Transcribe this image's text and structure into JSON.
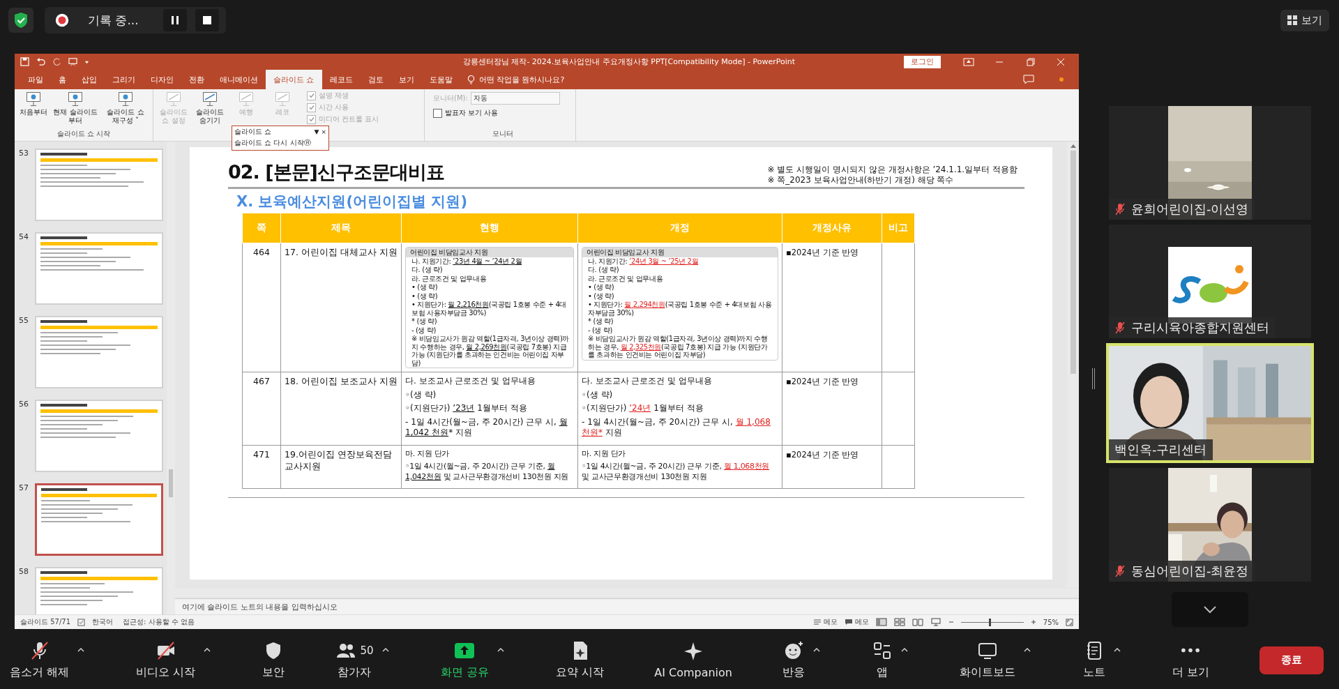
{
  "meeting": {
    "recording": "기록 중...",
    "view_button": "보기"
  },
  "powerpoint": {
    "title": "강릉센터장님 제작- 2024.보육사업안내 주요개정사항 PPT[Compatibility Mode]  -  PowerPoint",
    "login": "로그인",
    "tabs": [
      {
        "label": "파일",
        "selected": false
      },
      {
        "label": "홈",
        "selected": false
      },
      {
        "label": "삽입",
        "selected": false
      },
      {
        "label": "그리기",
        "selected": false
      },
      {
        "label": "디자인",
        "selected": false
      },
      {
        "label": "전환",
        "selected": false
      },
      {
        "label": "애니메이션",
        "selected": false
      },
      {
        "label": "슬라이드 쇼",
        "selected": true
      },
      {
        "label": "레코드",
        "selected": false
      },
      {
        "label": "검토",
        "selected": false
      },
      {
        "label": "보기",
        "selected": false
      },
      {
        "label": "도움말",
        "selected": false
      }
    ],
    "tell_me": "어떤 작업을 원하시나요?",
    "ribbon": {
      "start_group": {
        "label": "슬라이드 쇼 시작",
        "buttons": [
          {
            "label": "처음부터",
            "disabled": false
          },
          {
            "label": "현재 슬라이드부터",
            "disabled": false
          },
          {
            "label": "슬라이드 쇼 재구성",
            "caret": "˅",
            "disabled": false
          }
        ]
      },
      "setup_buttons": [
        {
          "label": "슬라이드 쇼 설정",
          "disabled": true
        },
        {
          "label": "슬라이드 숨기기",
          "disabled": false
        },
        {
          "label": "예행",
          "disabled": true
        },
        {
          "label": "레코",
          "disabled": true
        }
      ],
      "checks": [
        {
          "label": "설명 재생",
          "checked": true,
          "disabled": true
        },
        {
          "label": "시간 사용",
          "checked": true,
          "disabled": true
        },
        {
          "label": "미디어 컨트롤 표시",
          "checked": true,
          "disabled": true
        }
      ],
      "monitor_group": {
        "label": "모니터",
        "monitor_label": "모니터(M):",
        "monitor_value": "자동",
        "presenter": {
          "label": "발표자 보기 사용",
          "checked": false
        }
      }
    },
    "popup": {
      "title": "슬라이드 쇼",
      "menu_arrow": "▼",
      "close": "×",
      "item": "슬라이드 쇼 다시 시작Ⓡ"
    },
    "thumbnails": [
      {
        "number": "53",
        "selected": false
      },
      {
        "number": "54",
        "selected": false
      },
      {
        "number": "55",
        "selected": false
      },
      {
        "number": "56",
        "selected": false
      },
      {
        "number": "57",
        "selected": true
      },
      {
        "number": "58",
        "selected": false
      }
    ],
    "slide": {
      "title": "02. [본문]신구조문대비표",
      "notes": [
        "※ 별도 시행일이 명시되지 않은 개정사항은 ’24.1.1.일부터 적용함",
        "※ 쪽_2023 보육사업안내(하반기 개정) 해당 쪽수"
      ],
      "subtitle": "Ⅹ. 보육예산지원(어린이집별 지원)",
      "table": {
        "columns": [
          "쪽",
          "제목",
          "현행",
          "개정",
          "개정사유",
          "비고"
        ],
        "rows": [
          {
            "page": "464",
            "title": "17. 어린이집 대체교사 지원",
            "reason": "▪2024년 기준 반영",
            "current": {
              "kind": "box",
              "heading": "어린이집 비담임교사 지원",
              "lines": [
                [
                  {
                    "text": "나. 지원기간: "
                  },
                  {
                    "text": "’23년 4월 ~ ’24년 2월",
                    "kind": "underline"
                  }
                ],
                [
                  {
                    "text": "다. (생 략)"
                  }
                ],
                [
                  {
                    "text": "라. 근로조건 및 업무내용"
                  }
                ],
                [
                  {
                    "text": "• (생 략)"
                  }
                ],
                [
                  {
                    "text": "• (생 략)"
                  }
                ],
                [
                  {
                    "text": "• 지원단가: "
                  },
                  {
                    "text": "월 2,216천원",
                    "kind": "underline"
                  },
                  {
                    "text": "(국공립 1호봉 수준 + 4대보험 사용자부담금 30%)"
                  }
                ],
                [
                  {
                    "text": "* (생 략)"
                  }
                ],
                [
                  {
                    "text": "- (생 략)"
                  }
                ],
                [
                  {
                    "text": "※ 비담임교사가 원감 역할(1급자격, 3년이상 경력)까지 수행하는 경우, "
                  },
                  {
                    "text": "월 2,269천원",
                    "kind": "underline"
                  },
                  {
                    "text": "(국공립 7호봉) 지급 가능 (지원단가를 초과하는 인건비는 어린이집 자부담)"
                  }
                ]
              ]
            },
            "revised": {
              "kind": "box",
              "heading": "어린이집 비담임교사 지원",
              "lines": [
                [
                  {
                    "text": "나. 지원기간: "
                  },
                  {
                    "text": "’24년 3월 ~ ’25년 2월",
                    "kind": "changed"
                  }
                ],
                [
                  {
                    "text": "다. (생 략)"
                  }
                ],
                [
                  {
                    "text": "라. 근로조건 및 업무내용"
                  }
                ],
                [
                  {
                    "text": "• (생 략)"
                  }
                ],
                [
                  {
                    "text": "• (생 략)"
                  }
                ],
                [
                  {
                    "text": "• 지원단가: "
                  },
                  {
                    "text": "월 2,294천원",
                    "kind": "changed"
                  },
                  {
                    "text": "(국공립 1호봉 수준 + 4대보험 사용자부담금 30%)"
                  }
                ],
                [
                  {
                    "text": "* (생 략)"
                  }
                ],
                [
                  {
                    "text": "- (생 략)"
                  }
                ],
                [
                  {
                    "text": "※ 비담임교사가 원감 역할(1급자격, 3년이상 경력)까지 수행하는 경우, "
                  },
                  {
                    "text": "월 2,325천원",
                    "kind": "changed"
                  },
                  {
                    "text": "(국공립 7호봉) 지급 가능 (지원단가를 초과하는 인건비는 어린이집 자부담)"
                  }
                ]
              ]
            }
          },
          {
            "page": "467",
            "title": "18. 어린이집 보조교사 지원",
            "reason": "▪2024년 기준 반영",
            "current": {
              "kind": "text",
              "lines": [
                [
                  {
                    "text": "다. 보조교사 근로조건 및 업무내용"
                  }
                ],
                [
                  {
                    "text": "◦(생 략)"
                  }
                ],
                [
                  {
                    "text": "◦(지원단가) "
                  },
                  {
                    "text": "’23년",
                    "kind": "underline"
                  },
                  {
                    "text": " 1월부터 적용"
                  }
                ],
                [
                  {
                    "text": "- 1일 4시간(월~금, 주 20시간) 근무 시, "
                  },
                  {
                    "text": "월 1,042 천원",
                    "kind": "underline"
                  },
                  {
                    "text": "* 지원"
                  }
                ]
              ]
            },
            "revised": {
              "kind": "text",
              "lines": [
                [
                  {
                    "text": "다. 보조교사 근로조건 및 업무내용"
                  }
                ],
                [
                  {
                    "text": "◦(생 략)"
                  }
                ],
                [
                  {
                    "text": "◦(지원단가) "
                  },
                  {
                    "text": "’24년",
                    "kind": "changed"
                  },
                  {
                    "text": " 1월부터 적용"
                  }
                ],
                [
                  {
                    "text": "- 1일 4시간(월~금, 주 20시간) 근무 시, "
                  },
                  {
                    "text": "월 1,068천원*",
                    "kind": "changed"
                  },
                  {
                    "text": " 지원"
                  }
                ]
              ]
            }
          },
          {
            "page": "471",
            "title": "19.어린이집 연장보육전담교사지원",
            "reason": "▪2024년 기준 반영",
            "current": {
              "kind": "small",
              "lines": [
                [
                  {
                    "text": "마. 지원 단가"
                  }
                ],
                [
                  {
                    "text": "◦1일 4시간(월~금, 주 20시간) 근무 기준, "
                  },
                  {
                    "text": "월 1,042천원",
                    "kind": "underline"
                  },
                  {
                    "text": " 및 교사근무환경개선비 130천원 지원"
                  }
                ]
              ]
            },
            "revised": {
              "kind": "small",
              "lines": [
                [
                  {
                    "text": "마. 지원 단가"
                  }
                ],
                [
                  {
                    "text": "◦1일 4시간(월~금, 주 20시간) 근무 기준, "
                  },
                  {
                    "text": "월 1,068천원",
                    "kind": "changed"
                  },
                  {
                    "text": " 및 교사근무환경개선비 130천원 지원"
                  }
                ]
              ]
            }
          }
        ]
      }
    },
    "notes_placeholder": "여기에 슬라이드 노트의 내용을 입력하십시오",
    "status": {
      "slide": "슬라이드 57/71",
      "language": "한국어",
      "accessibility": "접근성: 사용할 수 없음",
      "notes": "메모",
      "comments": "메모",
      "zoom": "75%",
      "zoom_slider": {
        "level": 0.45
      }
    }
  },
  "participants": [
    {
      "name": "윤희어린이집-이선영",
      "muted": true,
      "speaking": false
    },
    {
      "name": "구리시육아종합지원센터",
      "muted": true,
      "speaking": false
    },
    {
      "name": "백인옥-구리센터",
      "muted": false,
      "speaking": true
    },
    {
      "name": "동심어린이집-최윤정",
      "muted": true,
      "speaking": false
    }
  ],
  "toolbar": [
    {
      "kind": "mic",
      "label": "음소거 해제",
      "muted": true,
      "caret": true
    },
    {
      "kind": "video",
      "label": "비디오 시작",
      "muted": true,
      "caret": true
    },
    {
      "kind": "security",
      "label": "보안",
      "muted": false,
      "caret": false
    },
    {
      "kind": "participants",
      "label": "참가자",
      "count": "50",
      "muted": false,
      "caret": true
    },
    {
      "kind": "share",
      "label": "화면 공유",
      "muted": false,
      "caret": true
    },
    {
      "kind": "summary",
      "label": "요약 시작",
      "muted": false,
      "caret": false
    },
    {
      "kind": "ai",
      "label": "AI Companion",
      "muted": false,
      "caret": false
    },
    {
      "kind": "reactions",
      "label": "반응",
      "muted": false,
      "caret": true
    },
    {
      "kind": "apps",
      "label": "앱",
      "muted": false,
      "caret": true
    },
    {
      "kind": "whiteboard",
      "label": "화이트보드",
      "muted": false,
      "caret": true
    },
    {
      "kind": "notes",
      "label": "노트",
      "muted": false,
      "caret": true
    },
    {
      "kind": "more",
      "label": "더 보기",
      "muted": false,
      "caret": false
    }
  ],
  "end_button": "종료"
}
